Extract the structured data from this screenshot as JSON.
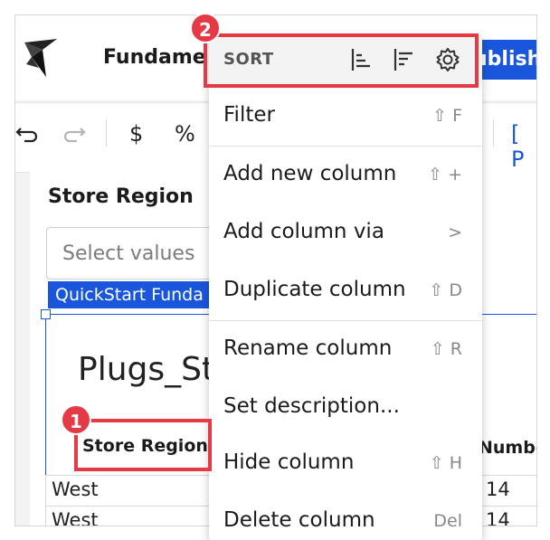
{
  "header": {
    "app_title": "Fundame",
    "publish_label": "ublish"
  },
  "toolbar": {
    "undo_icon": "undo-icon",
    "redo_icon": "redo-icon",
    "currency": "$",
    "percent": "%",
    "bracket": "[ P"
  },
  "filter": {
    "label": "Store Region",
    "placeholder": "Select values",
    "chip": "QuickStart Funda"
  },
  "table": {
    "title": "Plugs_St",
    "column_header": "Store Region",
    "column_header2": "Numbe",
    "rows": [
      {
        "region": "West",
        "number": "14"
      },
      {
        "region": "West",
        "number": "14"
      }
    ]
  },
  "menu": {
    "sort_label": "SORT",
    "items": [
      {
        "label": "Filter",
        "shortcut": "⇧ F"
      },
      {
        "label": "Add new column",
        "shortcut": "⇧ +"
      },
      {
        "label": "Add column via",
        "shortcut": ">"
      },
      {
        "label": "Duplicate column",
        "shortcut": "⇧ D"
      },
      {
        "label": "Rename column",
        "shortcut": "⇧ R"
      },
      {
        "label": "Set description...",
        "shortcut": ""
      },
      {
        "label": "Hide column",
        "shortcut": "⇧ H"
      },
      {
        "label": "Delete column",
        "shortcut": "Del"
      }
    ]
  },
  "annotations": {
    "badge1": "1",
    "badge2": "2"
  },
  "colors": {
    "accent": "#1a56db",
    "annotation": "#e63946"
  }
}
